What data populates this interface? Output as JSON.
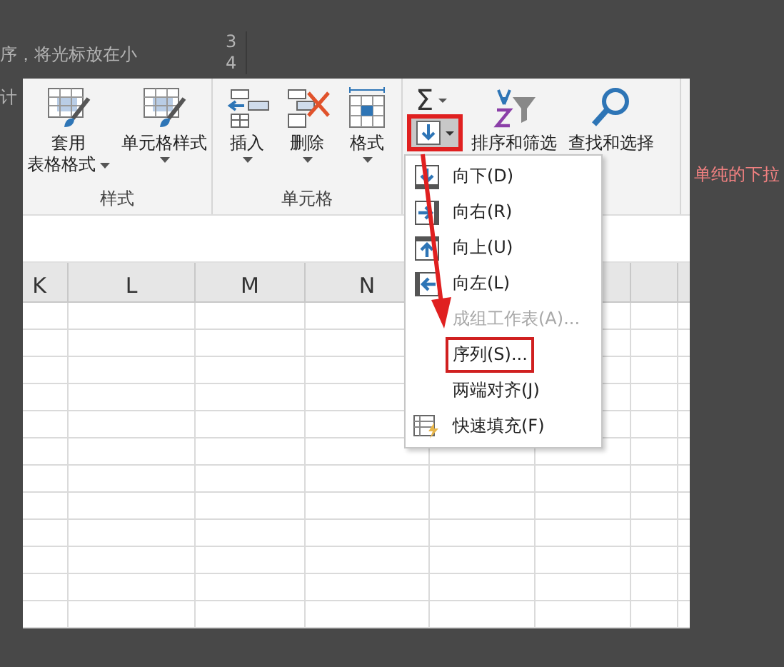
{
  "background": {
    "lines": [
      "序，将光标放在小",
      "计"
    ],
    "row_numbers": [
      "3",
      "4"
    ],
    "note": "单纯的下拉"
  },
  "ribbon": {
    "groups": [
      {
        "label": "样式",
        "buttons": [
          {
            "kind": "table-style",
            "lines": [
              "套用",
              "表格格式"
            ],
            "caret": true
          },
          {
            "kind": "cell-style",
            "lines": [
              "单元格样式"
            ],
            "caret": true
          }
        ]
      },
      {
        "label": "单元格",
        "buttons": [
          {
            "kind": "insert",
            "lines": [
              "插入"
            ],
            "caret": true
          },
          {
            "kind": "delete",
            "lines": [
              "删除"
            ],
            "caret": true
          },
          {
            "kind": "format",
            "lines": [
              "格式"
            ],
            "caret": true
          }
        ]
      }
    ],
    "editing": {
      "sum": "Σ",
      "fill_annotated": true,
      "buttons": [
        {
          "kind": "sort",
          "lines": [
            "排序和筛选"
          ]
        },
        {
          "kind": "find",
          "lines": [
            "查找和选择"
          ]
        }
      ]
    }
  },
  "columns": [
    "K",
    "L",
    "M",
    "N"
  ],
  "menu": {
    "items": [
      {
        "kind": "down",
        "label": "向下(D)",
        "disabled": false,
        "annotated": false
      },
      {
        "kind": "right",
        "label": "向右(R)",
        "disabled": false,
        "annotated": false
      },
      {
        "kind": "up",
        "label": "向上(U)",
        "disabled": false,
        "annotated": false
      },
      {
        "kind": "left",
        "label": "向左(L)",
        "disabled": false,
        "annotated": false
      },
      {
        "kind": "plain",
        "label": "成组工作表(A)...",
        "disabled": true,
        "annotated": false
      },
      {
        "kind": "plain",
        "label": "序列(S)...",
        "disabled": false,
        "annotated": true
      },
      {
        "kind": "plain",
        "label": "两端对齐(J)",
        "disabled": false,
        "annotated": false
      },
      {
        "kind": "flash",
        "label": "快速填充(F)",
        "disabled": false,
        "annotated": false
      }
    ]
  }
}
